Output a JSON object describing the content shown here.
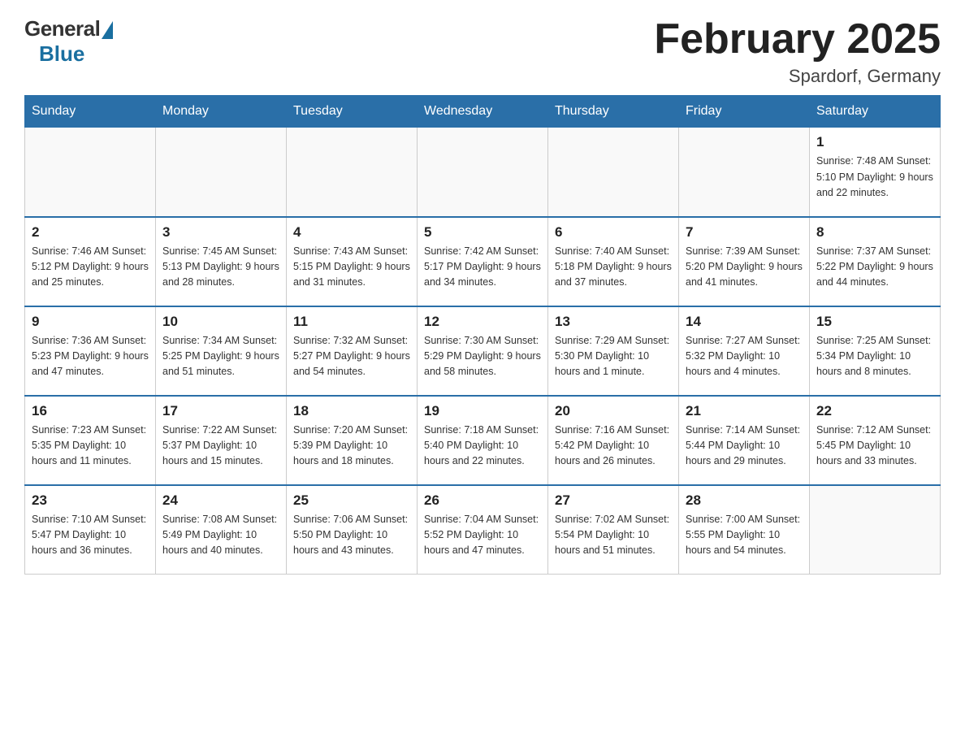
{
  "logo": {
    "general": "General",
    "blue": "Blue"
  },
  "title": "February 2025",
  "location": "Spardorf, Germany",
  "weekdays": [
    "Sunday",
    "Monday",
    "Tuesday",
    "Wednesday",
    "Thursday",
    "Friday",
    "Saturday"
  ],
  "weeks": [
    [
      {
        "day": "",
        "info": ""
      },
      {
        "day": "",
        "info": ""
      },
      {
        "day": "",
        "info": ""
      },
      {
        "day": "",
        "info": ""
      },
      {
        "day": "",
        "info": ""
      },
      {
        "day": "",
        "info": ""
      },
      {
        "day": "1",
        "info": "Sunrise: 7:48 AM\nSunset: 5:10 PM\nDaylight: 9 hours and 22 minutes."
      }
    ],
    [
      {
        "day": "2",
        "info": "Sunrise: 7:46 AM\nSunset: 5:12 PM\nDaylight: 9 hours and 25 minutes."
      },
      {
        "day": "3",
        "info": "Sunrise: 7:45 AM\nSunset: 5:13 PM\nDaylight: 9 hours and 28 minutes."
      },
      {
        "day": "4",
        "info": "Sunrise: 7:43 AM\nSunset: 5:15 PM\nDaylight: 9 hours and 31 minutes."
      },
      {
        "day": "5",
        "info": "Sunrise: 7:42 AM\nSunset: 5:17 PM\nDaylight: 9 hours and 34 minutes."
      },
      {
        "day": "6",
        "info": "Sunrise: 7:40 AM\nSunset: 5:18 PM\nDaylight: 9 hours and 37 minutes."
      },
      {
        "day": "7",
        "info": "Sunrise: 7:39 AM\nSunset: 5:20 PM\nDaylight: 9 hours and 41 minutes."
      },
      {
        "day": "8",
        "info": "Sunrise: 7:37 AM\nSunset: 5:22 PM\nDaylight: 9 hours and 44 minutes."
      }
    ],
    [
      {
        "day": "9",
        "info": "Sunrise: 7:36 AM\nSunset: 5:23 PM\nDaylight: 9 hours and 47 minutes."
      },
      {
        "day": "10",
        "info": "Sunrise: 7:34 AM\nSunset: 5:25 PM\nDaylight: 9 hours and 51 minutes."
      },
      {
        "day": "11",
        "info": "Sunrise: 7:32 AM\nSunset: 5:27 PM\nDaylight: 9 hours and 54 minutes."
      },
      {
        "day": "12",
        "info": "Sunrise: 7:30 AM\nSunset: 5:29 PM\nDaylight: 9 hours and 58 minutes."
      },
      {
        "day": "13",
        "info": "Sunrise: 7:29 AM\nSunset: 5:30 PM\nDaylight: 10 hours and 1 minute."
      },
      {
        "day": "14",
        "info": "Sunrise: 7:27 AM\nSunset: 5:32 PM\nDaylight: 10 hours and 4 minutes."
      },
      {
        "day": "15",
        "info": "Sunrise: 7:25 AM\nSunset: 5:34 PM\nDaylight: 10 hours and 8 minutes."
      }
    ],
    [
      {
        "day": "16",
        "info": "Sunrise: 7:23 AM\nSunset: 5:35 PM\nDaylight: 10 hours and 11 minutes."
      },
      {
        "day": "17",
        "info": "Sunrise: 7:22 AM\nSunset: 5:37 PM\nDaylight: 10 hours and 15 minutes."
      },
      {
        "day": "18",
        "info": "Sunrise: 7:20 AM\nSunset: 5:39 PM\nDaylight: 10 hours and 18 minutes."
      },
      {
        "day": "19",
        "info": "Sunrise: 7:18 AM\nSunset: 5:40 PM\nDaylight: 10 hours and 22 minutes."
      },
      {
        "day": "20",
        "info": "Sunrise: 7:16 AM\nSunset: 5:42 PM\nDaylight: 10 hours and 26 minutes."
      },
      {
        "day": "21",
        "info": "Sunrise: 7:14 AM\nSunset: 5:44 PM\nDaylight: 10 hours and 29 minutes."
      },
      {
        "day": "22",
        "info": "Sunrise: 7:12 AM\nSunset: 5:45 PM\nDaylight: 10 hours and 33 minutes."
      }
    ],
    [
      {
        "day": "23",
        "info": "Sunrise: 7:10 AM\nSunset: 5:47 PM\nDaylight: 10 hours and 36 minutes."
      },
      {
        "day": "24",
        "info": "Sunrise: 7:08 AM\nSunset: 5:49 PM\nDaylight: 10 hours and 40 minutes."
      },
      {
        "day": "25",
        "info": "Sunrise: 7:06 AM\nSunset: 5:50 PM\nDaylight: 10 hours and 43 minutes."
      },
      {
        "day": "26",
        "info": "Sunrise: 7:04 AM\nSunset: 5:52 PM\nDaylight: 10 hours and 47 minutes."
      },
      {
        "day": "27",
        "info": "Sunrise: 7:02 AM\nSunset: 5:54 PM\nDaylight: 10 hours and 51 minutes."
      },
      {
        "day": "28",
        "info": "Sunrise: 7:00 AM\nSunset: 5:55 PM\nDaylight: 10 hours and 54 minutes."
      },
      {
        "day": "",
        "info": ""
      }
    ]
  ]
}
